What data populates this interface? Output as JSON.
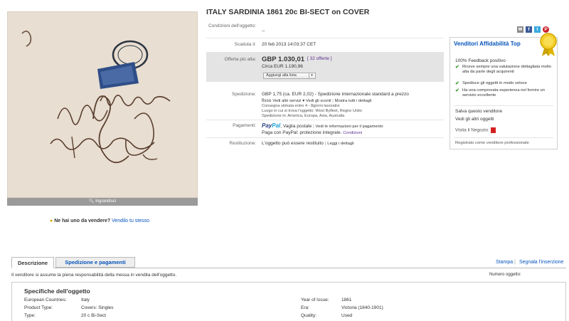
{
  "title": "ITALY SARDINIA 1861 20c BI-SECT on COVER",
  "photo": {
    "enlarge_label": "Ingrandisci",
    "sell_question": "Ne hai uno da vendere?",
    "sell_link": "Vendilo tu stesso"
  },
  "condition": {
    "label": "Condizioni dell'oggetto:",
    "value": "--"
  },
  "ended": {
    "label": "Scaduta il:",
    "value": "20 feb 2013 14:03:37 CET"
  },
  "bid": {
    "label": "Offerta più alta:",
    "price": "GBP 1.030,01",
    "offers": "[ 32 offerte ]",
    "approx": "Circa EUR 1.190,96",
    "watch_button": "Aggiungi alla lista"
  },
  "shipping": {
    "label": "Spedizione:",
    "line1": "GBP 1,75 (ca. EUR 2,02) - Spedizione internazionale standard a prezzo",
    "line2_prefix": "fisso",
    "other_services": "Vedi altri servizi",
    "see_costs": "Vedi gli sconti",
    "show_details": "Mostra tutti i dettagli",
    "delivery": "Consegna stimata entro 4 - 8giorni lavorativi",
    "location": "Luogo in cui si trova l'oggetto: West Byfleet, Regno Unito",
    "ships_to": "Spedizione in: America, Europa, Asia, Australia"
  },
  "payments": {
    "label": "Pagamenti:",
    "paypal_logo_a": "Pay",
    "paypal_logo_b": "Pal",
    "paypal_text": ", Vaglia postale",
    "info_link": "Vedi le informazioni per il pagamento",
    "protection": "Paga con PayPal: protezione integrale.",
    "conditions_link": "Condizioni"
  },
  "returns": {
    "label": "Restituzione:",
    "value": "L'oggetto può essere restituito",
    "details_link": "Leggi i dettagli"
  },
  "seller": {
    "heading": "Venditori Affidabilità Top",
    "feedback": "100% Feedback positivo",
    "perks": [
      "Riceve sempre una valutazione dettagliata molto alta da parte degli acquirenti",
      "Spedisce gli oggetti in modo veloce",
      "Ha una comprovata esperienza nel fornire un servizio eccellente"
    ],
    "save_link": "Salva questo venditore",
    "other_items_link": "Vedi gli altri oggetti",
    "visit_store": "Visita il Negozio:",
    "registered": "Registrato come venditore professionale"
  },
  "share": [
    "mail-icon",
    "facebook-icon",
    "twitter-icon",
    "pinterest-icon"
  ],
  "tabs": {
    "description": "Descrizione",
    "shipping": "Spedizione e pagamenti"
  },
  "actions": {
    "print": "Stampa",
    "separator": "|",
    "report": "Segnala l'inserzione"
  },
  "responsibility": "Il venditore si assume la piena responsabilità della messa in vendita dell'oggetto.",
  "item_number_label": "Numero oggetto:",
  "specs": {
    "title": "Specifiche dell'oggetto",
    "left": [
      {
        "k": "European Countries:",
        "v": "Italy"
      },
      {
        "k": "Product Type:",
        "v": "Covers: Singles"
      },
      {
        "k": "Type:",
        "v": "20 c Bi-Sect"
      }
    ],
    "right": [
      {
        "k": "Year of Issue:",
        "v": "1861"
      },
      {
        "k": "Era:",
        "v": "Victoria (1840-1901)"
      },
      {
        "k": "Quality:",
        "v": "Used"
      }
    ]
  },
  "colors": {
    "link": "#0654ba",
    "offers": "#5b2d91",
    "bid_bg": "#e4e4e4",
    "check": "#3a9a2f"
  }
}
